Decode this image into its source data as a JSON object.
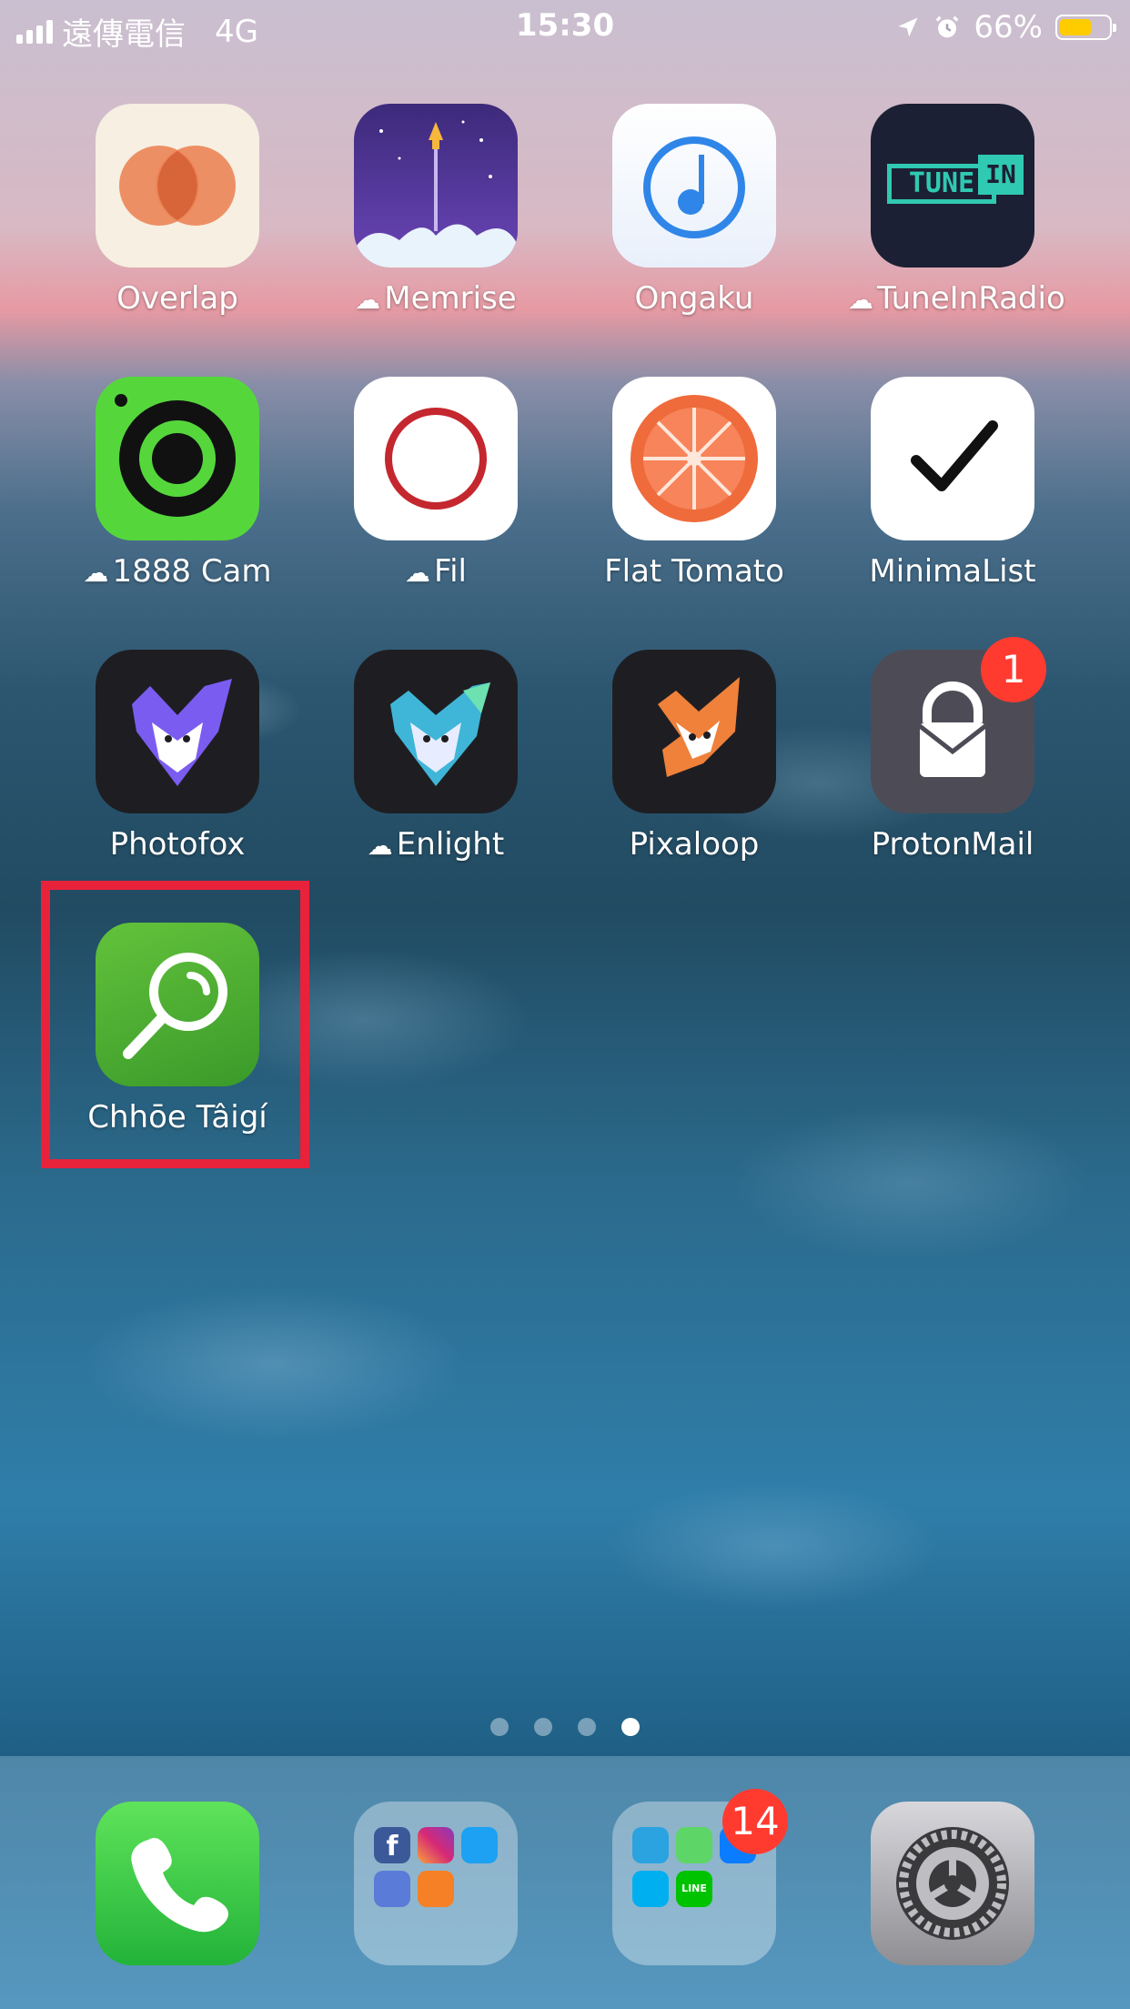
{
  "status_bar": {
    "carrier": "遠傳電信",
    "network": "4G",
    "time": "15:30",
    "battery_percent": "66%",
    "battery_level": 0.66
  },
  "apps": [
    {
      "label": "Overlap",
      "icon": "overlap-icon",
      "cloud": false
    },
    {
      "label": "Memrise",
      "icon": "memrise-icon",
      "cloud": true
    },
    {
      "label": "Ongaku",
      "icon": "ongaku-icon",
      "cloud": false
    },
    {
      "label": "TuneInRadio",
      "icon": "tunein-icon",
      "cloud": true,
      "icon_text_1": "TUNE",
      "icon_text_2": "IN"
    },
    {
      "label": "1888 Cam",
      "icon": "camera-icon",
      "cloud": true
    },
    {
      "label": "Fil",
      "icon": "fil-icon",
      "cloud": true
    },
    {
      "label": "Flat Tomato",
      "icon": "tomato-icon",
      "cloud": false
    },
    {
      "label": "MinimaList",
      "icon": "checkmark-icon",
      "cloud": false
    },
    {
      "label": "Photofox",
      "icon": "photofox-icon",
      "cloud": false
    },
    {
      "label": "Enlight",
      "icon": "enlight-icon",
      "cloud": true
    },
    {
      "label": "Pixaloop",
      "icon": "pixaloop-icon",
      "cloud": false
    },
    {
      "label": "ProtonMail",
      "icon": "protonmail-icon",
      "cloud": false,
      "badge": "1"
    },
    {
      "label": "Chhōe Tâigí",
      "icon": "magnifier-icon",
      "cloud": false
    }
  ],
  "page_dots": {
    "count": 4,
    "active": 4
  },
  "dock": {
    "folder_badge": "14",
    "line_text": "LINE"
  },
  "colors": {
    "highlight": "#e8223b",
    "badge": "#ff3b30",
    "battery": "#ffcc00"
  }
}
